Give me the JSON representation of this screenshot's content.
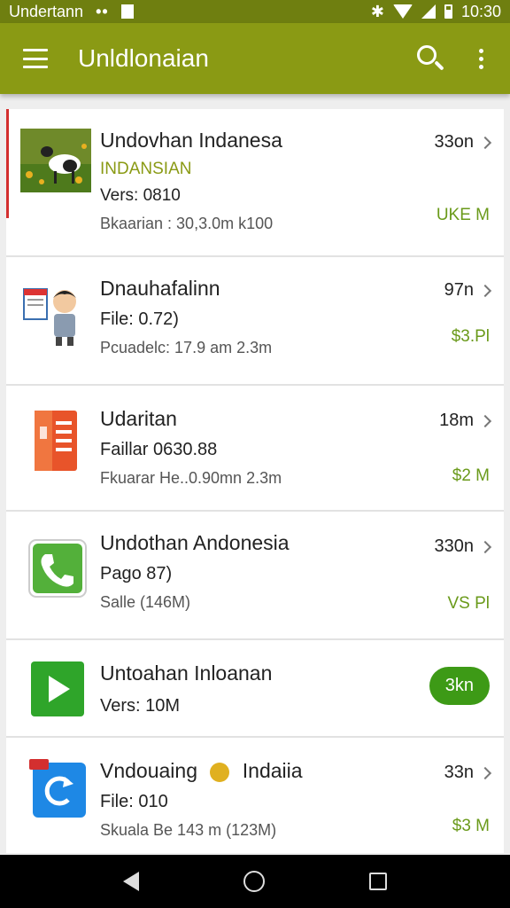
{
  "status": {
    "carrier": "Undertann",
    "time": "10:30"
  },
  "appbar": {
    "title": "Unldlonaian"
  },
  "items": [
    {
      "title": "Undovhan Indanesa",
      "sub": "INDANSIAN",
      "line2": "Vers: 0810",
      "line3": "Bkaarian : 30,3.0m k100",
      "size": "33on",
      "price": "UKE M"
    },
    {
      "title": "Dnauhafalinn",
      "sub": "File: 0.72)",
      "line3": "Pcuadelc: 17.9 am 2.3m",
      "size": "97n",
      "price": "$3.Pl"
    },
    {
      "title": "Udaritan",
      "sub": "Faillar 0630.88",
      "line3": "Fkuarar He..0.90mn 2.3m",
      "size": "18m",
      "price": "$2 M"
    },
    {
      "title": "Undothan Andonesia",
      "sub": "Pago 87)",
      "line3": "Salle (146M)",
      "size": "330n",
      "price": "VS Pl"
    },
    {
      "title": "Untoahan Inloanan",
      "sub": "Vers: 10M",
      "pill": "3kn"
    },
    {
      "title": "Vndouaing",
      "title_b": "Indaiia",
      "sub": "File: 010",
      "line3": "Skuala Be 143 m (123M)",
      "size": "33n",
      "price": "$3 M"
    }
  ]
}
